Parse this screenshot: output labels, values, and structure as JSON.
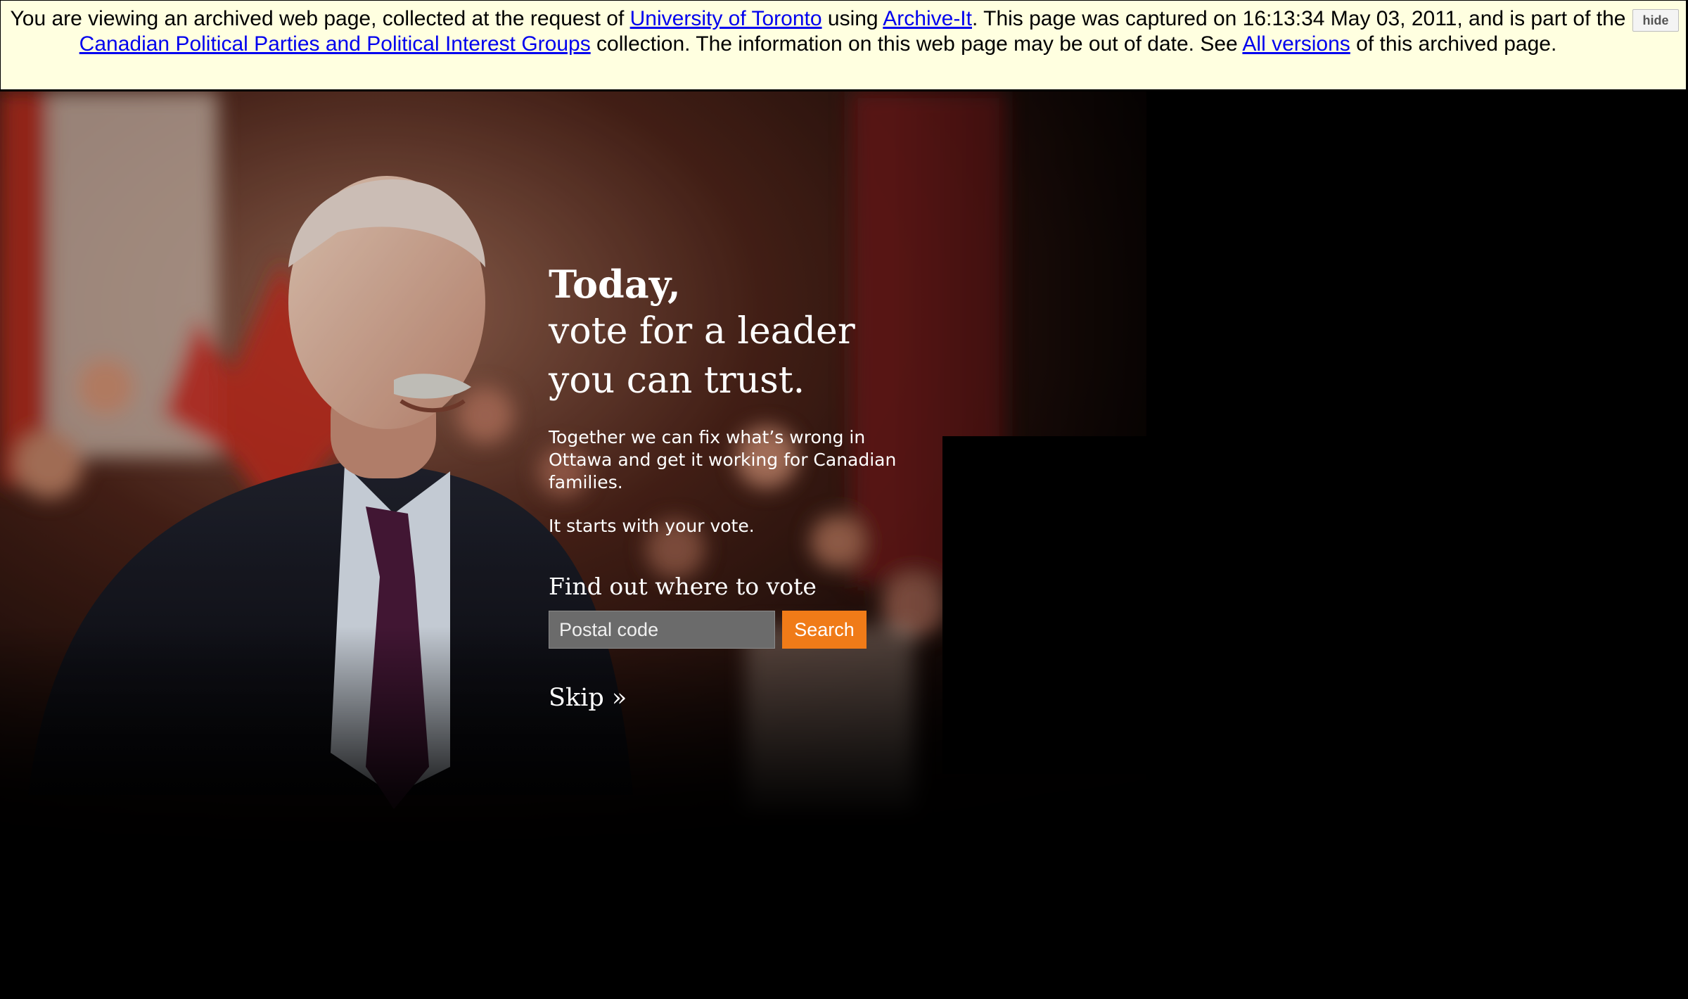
{
  "archive_banner": {
    "text_before_org": "You are viewing an archived web page, collected at the request of ",
    "org_link": "University of Toronto",
    "text_using": " using ",
    "tool_link": "Archive-It",
    "text_capture": ". This page was captured on 16:13:34 May 03, 2011, and is part of the ",
    "collection_link": "Canadian Political Parties and Political Interest Groups",
    "text_collection": " collection. The information on this web page may be out of date. See ",
    "versions_link": "All versions",
    "text_end": " of this archived page.",
    "hide_label": "hide"
  },
  "hero": {
    "headline_strong": "Today,",
    "headline_line2": "vote for a leader",
    "headline_line3": "you can trust.",
    "body": "Together we can fix what’s wrong in Ottawa and get it working for Canadian families.",
    "body2": "It starts with your vote.",
    "find_vote_title": "Find out where to vote",
    "postal_placeholder": "Postal code",
    "search_label": "Search",
    "skip_label": "Skip »"
  },
  "colors": {
    "banner_bg": "#ffffe0",
    "link": "#0000ee",
    "accent_orange": "#f07b18",
    "input_bg": "#6b6b6b"
  }
}
